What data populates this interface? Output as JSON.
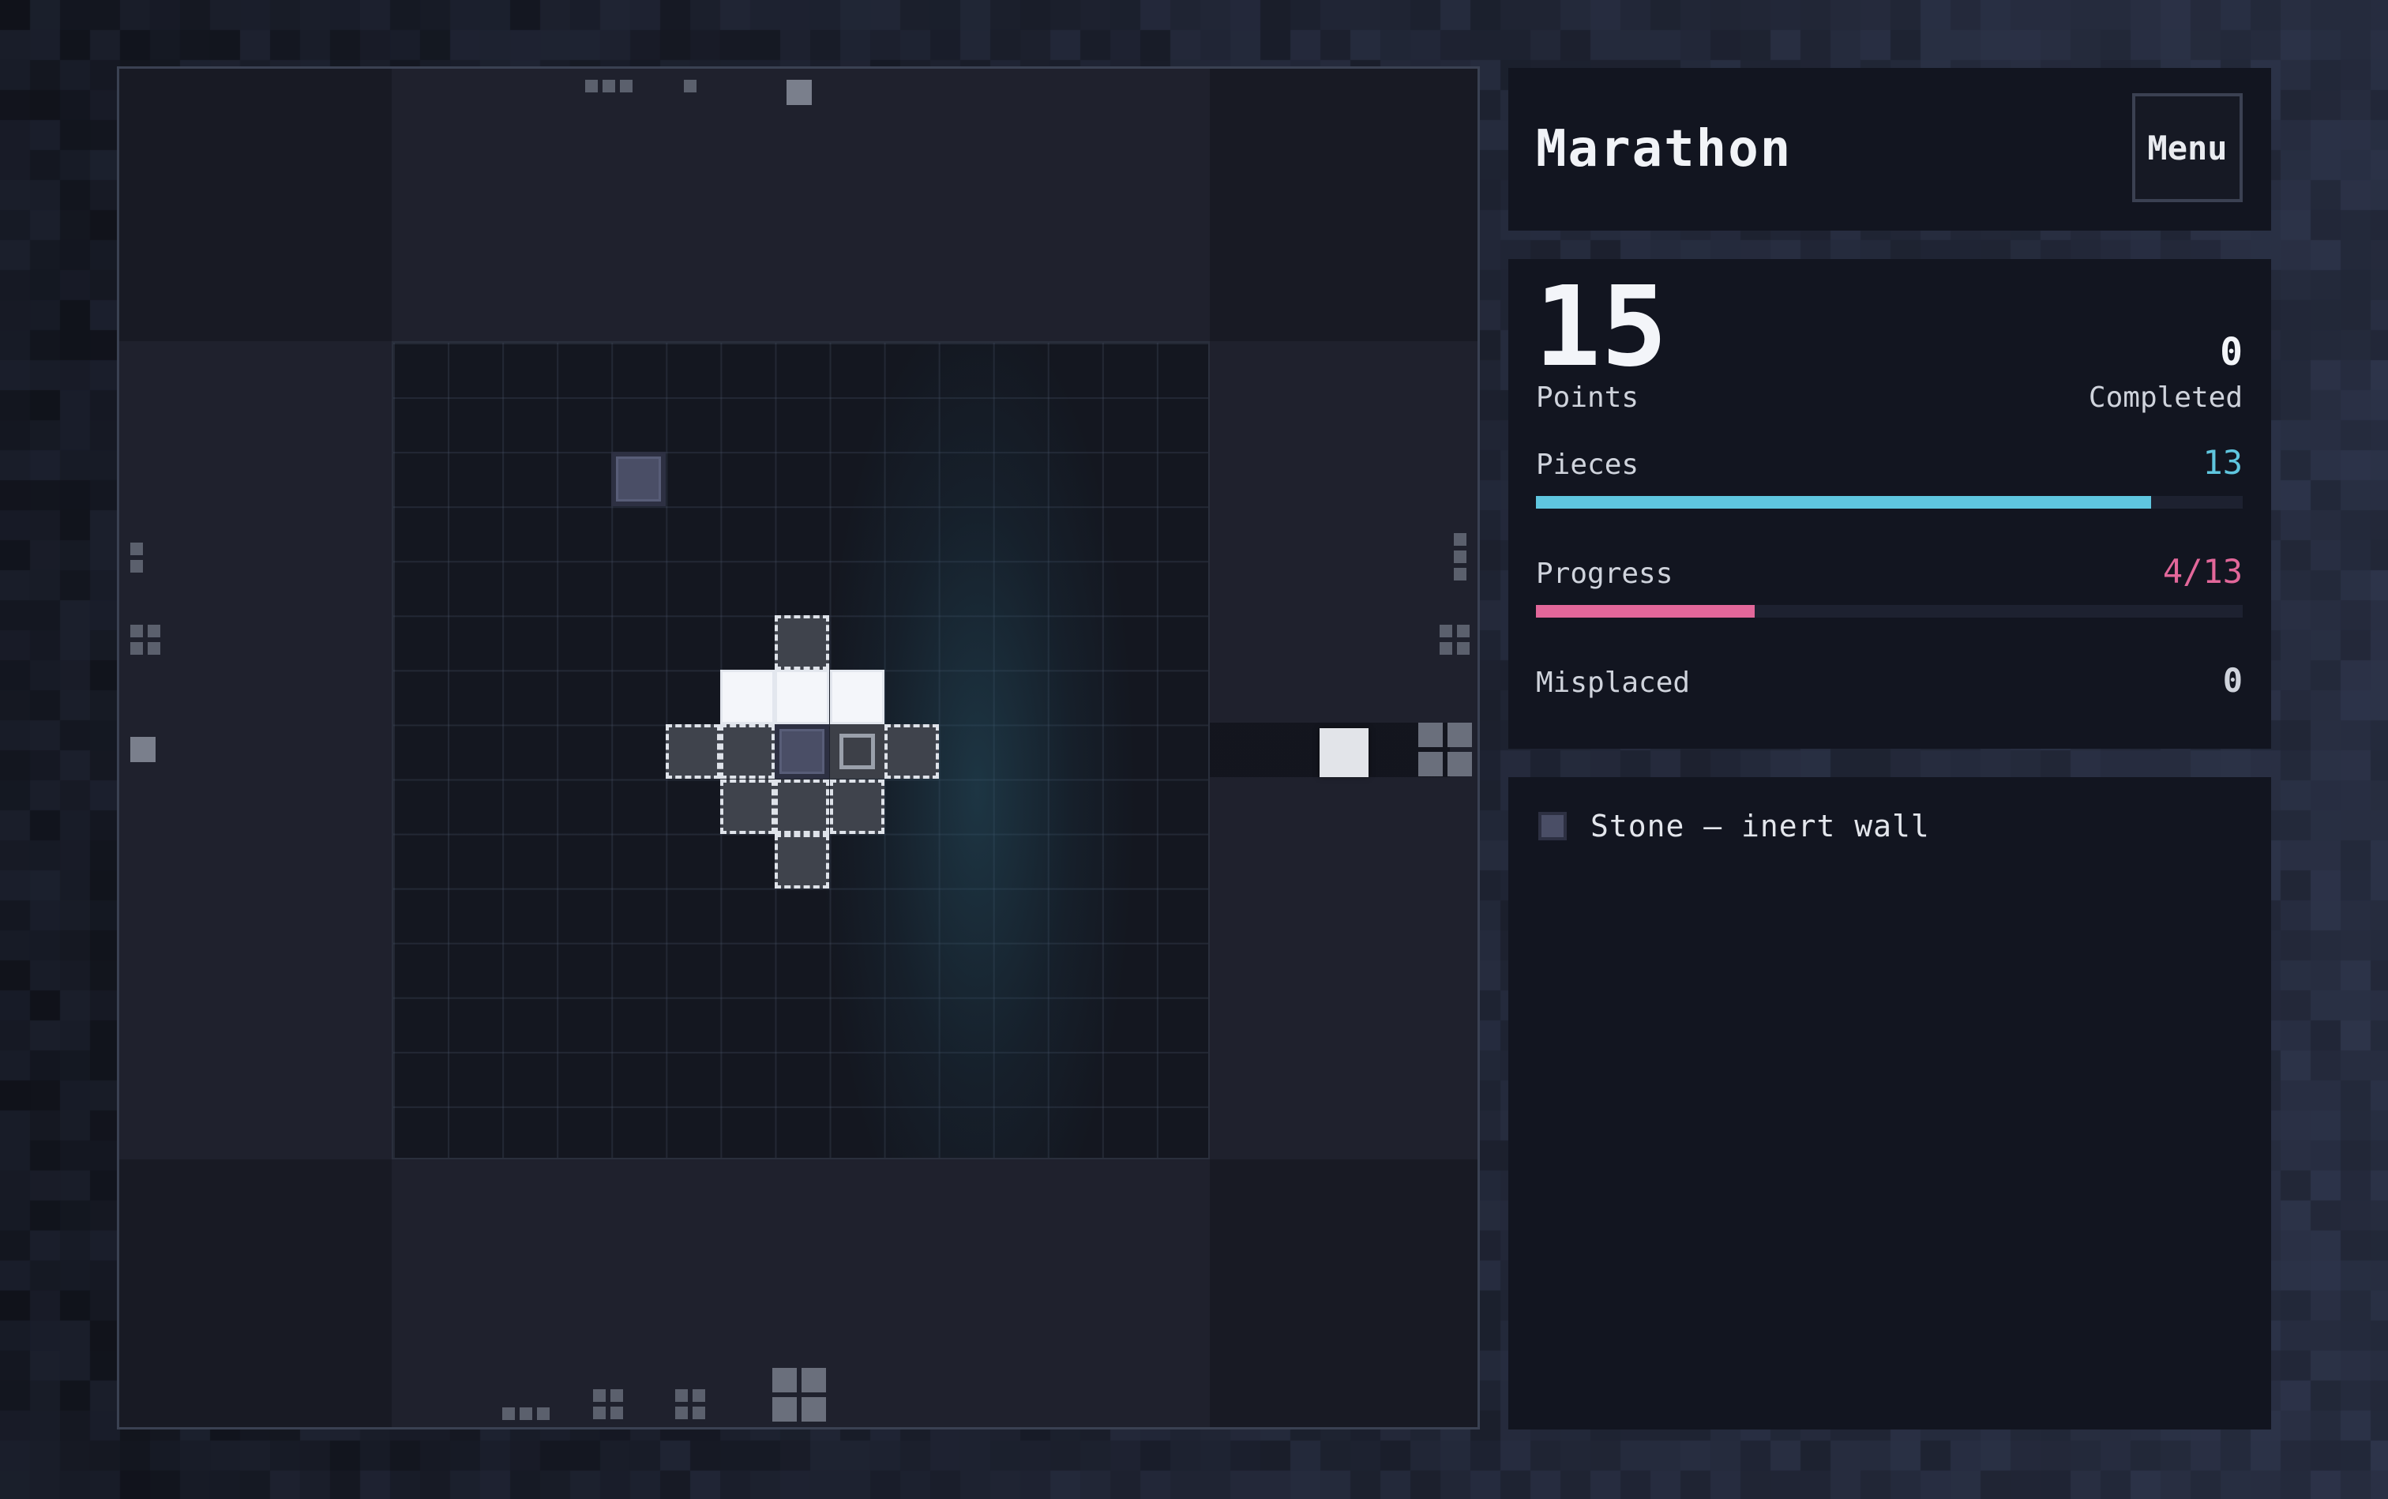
{
  "title": "Marathon",
  "menu_label": "Menu",
  "stats": {
    "points_value": "15",
    "points_label": "Points",
    "completed_value": "0",
    "completed_label": "Completed",
    "pieces_label": "Pieces",
    "pieces_value": "13",
    "pieces_fill": 0.87,
    "progress_label": "Progress",
    "progress_value": "4/13",
    "progress_fill": 0.31,
    "misplaced_label": "Misplaced",
    "misplaced_value": "0"
  },
  "legend": {
    "stone_label": "Stone — inert wall"
  },
  "colors": {
    "accent_cyan": "#5fc6df",
    "accent_pink": "#e2679a",
    "stone": "#4a4e66",
    "panel_bg": "#121520"
  },
  "board": {
    "grid_size": 15,
    "piece_cells_white": [
      [
        6,
        6
      ],
      [
        7,
        6
      ],
      [
        8,
        6
      ]
    ],
    "piece_cells_ghost": [
      [
        7,
        5
      ],
      [
        5,
        7
      ],
      [
        6,
        7
      ],
      [
        9,
        7
      ],
      [
        6,
        8
      ],
      [
        7,
        8
      ],
      [
        8,
        8
      ],
      [
        7,
        9
      ]
    ],
    "stone_cells": [
      [
        4,
        2
      ],
      [
        7,
        7
      ]
    ],
    "hollow_cells": [
      [
        8,
        7
      ]
    ]
  }
}
